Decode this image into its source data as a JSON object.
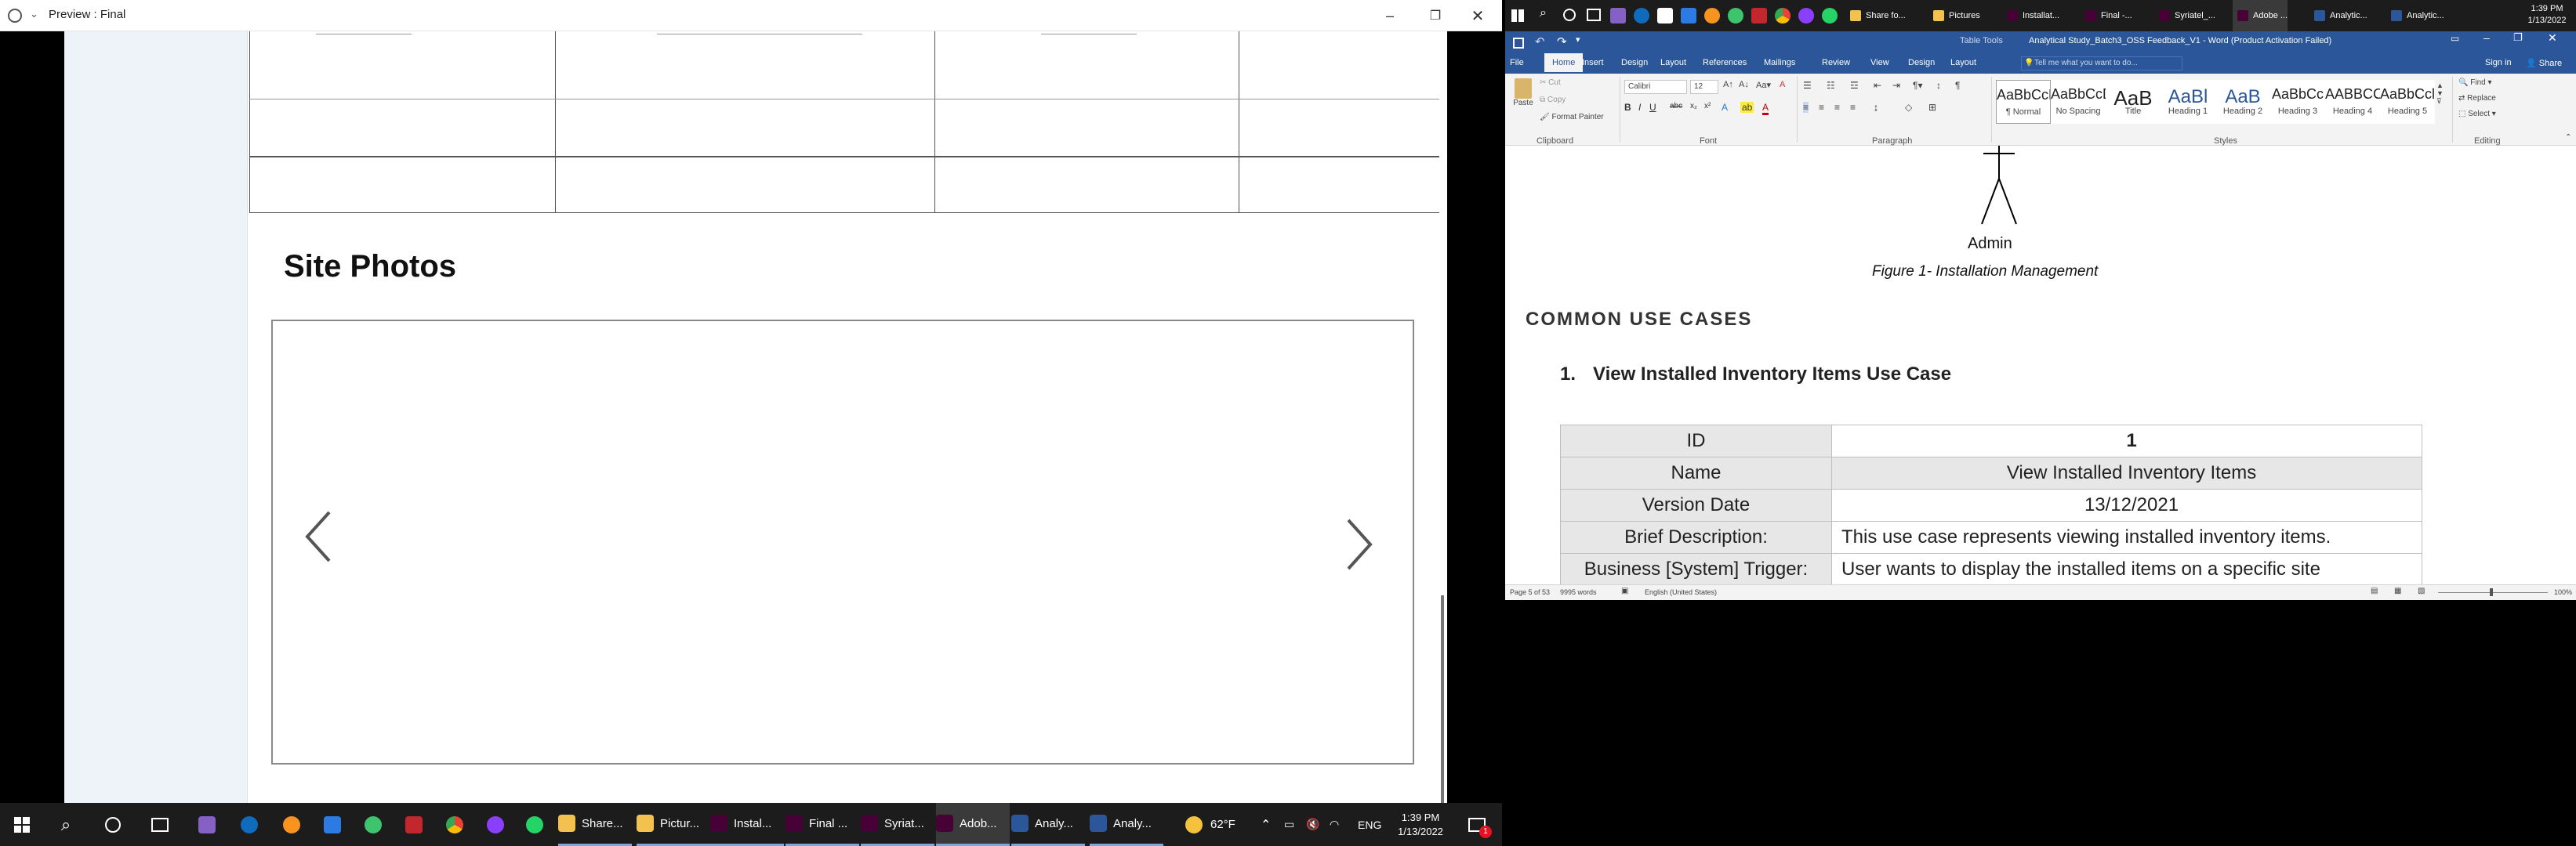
{
  "left_window": {
    "title": "Preview : Final",
    "section_title": "Site Photos",
    "carousel": {
      "prev_icon": "chevron-left-icon",
      "next_icon": "chevron-right-icon"
    }
  },
  "word": {
    "title": "Analytical Study_Batch3_OSS Feedback_V1 - Word (Product Activation Failed)",
    "contextual_tab": "Table Tools",
    "sign_in": "Sign in",
    "share": "Share",
    "tell_me": "Tell me what you want to do...",
    "tabs": [
      "File",
      "Home",
      "Insert",
      "Design",
      "Layout",
      "References",
      "Mailings",
      "Review",
      "View",
      "Design",
      "Layout"
    ],
    "active_tab": "Home",
    "clipboard": {
      "paste": "Paste",
      "cut": "Cut",
      "copy": "Copy",
      "format_painter": "Format Painter",
      "group": "Clipboard"
    },
    "font": {
      "name": "Calibri",
      "size": "12",
      "group": "Font"
    },
    "paragraph_group": "Paragraph",
    "styles_group": "Styles",
    "styles": [
      {
        "preview": "AaBbCcD",
        "name": "¶ Normal"
      },
      {
        "preview": "AaBbCcDc",
        "name": "No Spacing"
      },
      {
        "preview": "AaB",
        "name": "Title"
      },
      {
        "preview": "AaBl",
        "name": "Heading 1"
      },
      {
        "preview": "AaB",
        "name": "Heading 2"
      },
      {
        "preview": "AaBbCc",
        "name": "Heading 3"
      },
      {
        "preview": "AABBCC",
        "name": "Heading 4"
      },
      {
        "preview": "AaBbCcl",
        "name": "Heading 5"
      }
    ],
    "editing": {
      "find": "Find",
      "replace": "Replace",
      "select": "Select",
      "group": "Editing"
    },
    "doc": {
      "actor_label": "Admin",
      "figure_caption": "Figure 1- Installation Management",
      "section_heading": "COMMON USE CASES",
      "item_number": "1.",
      "item_heading": "View Installed Inventory Items Use Case",
      "table": [
        {
          "k": "ID",
          "v": "1"
        },
        {
          "k": "Name",
          "v": "View Installed Inventory Items"
        },
        {
          "k": "Version Date",
          "v": "13/12/2021"
        },
        {
          "k": "Brief Description:",
          "v": "This use case represents viewing installed inventory items."
        },
        {
          "k": "Business [System] Trigger:",
          "v": "User wants to display the installed items on a specific site"
        }
      ]
    },
    "status": {
      "page": "Page 5 of 53",
      "words": "9995 words",
      "language": "English (United States)",
      "zoom": "100%"
    }
  },
  "taskbar": {
    "items": [
      {
        "label": "Share...",
        "icon": "file-explorer-icon",
        "color": "#f2c14e"
      },
      {
        "label": "Pictur...",
        "icon": "folder-icon",
        "color": "#f2c14e"
      },
      {
        "label": "Instal...",
        "icon": "adobe-xd-icon",
        "color": "#470137"
      },
      {
        "label": "Final ...",
        "icon": "adobe-xd-icon",
        "color": "#470137"
      },
      {
        "label": "Syriat...",
        "icon": "adobe-xd-icon",
        "color": "#470137"
      },
      {
        "label": "Adob...",
        "icon": "adobe-xd-icon",
        "color": "#470137"
      },
      {
        "label": "Analy...",
        "icon": "word-icon",
        "color": "#2b579a"
      },
      {
        "label": "Analy...",
        "icon": "word-icon",
        "color": "#2b579a"
      }
    ],
    "weather": "62°F",
    "language": "ENG",
    "time": "1:39 PM",
    "date": "1/13/2022",
    "notification_count": "1"
  },
  "word_taskbar": {
    "items": [
      "Share fo...",
      "Pictures",
      "Installat...",
      "Final -...",
      "Syriatel_...",
      "Adobe ...",
      "Analytic...",
      "Analytic..."
    ],
    "time": "1:39 PM",
    "date": "1/13/2022"
  },
  "colors": {
    "word_blue": "#2b579a",
    "xd": "#470137",
    "taskbar": "#1c1c1c"
  }
}
